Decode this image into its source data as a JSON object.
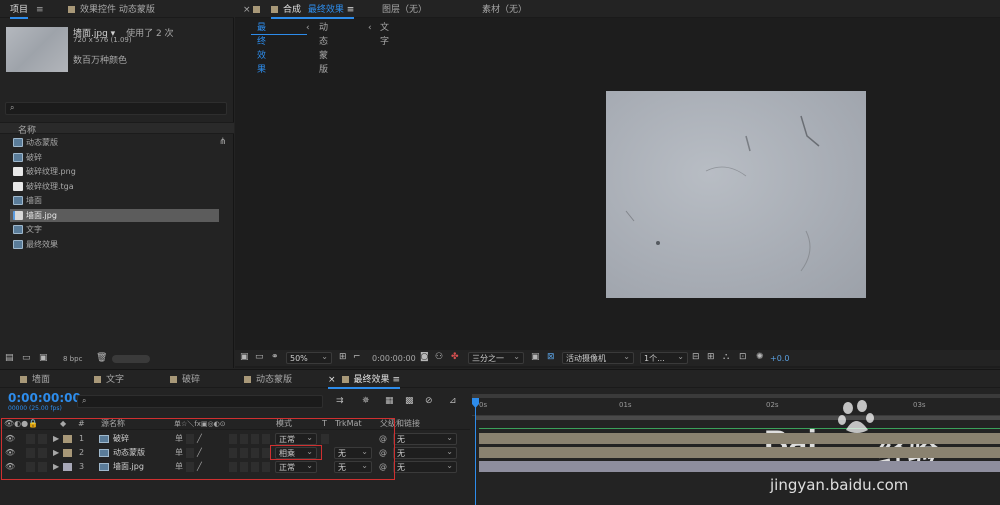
{
  "project_panel": {
    "tab_project": "项目",
    "tab_effects": "效果控件 动态蒙版",
    "file_name": "墙面.jpg",
    "file_menu": "▾",
    "used_count": "使用了 2 次",
    "dimensions": "720 x 576 (1.09)",
    "colors": "数百万种颜色",
    "search_placeholder": "",
    "column_name": "名称",
    "items": [
      {
        "name": "动态蒙版",
        "type": "comp"
      },
      {
        "name": "破碎",
        "type": "comp"
      },
      {
        "name": "破碎纹理.png",
        "type": "file"
      },
      {
        "name": "破碎纹理.tga",
        "type": "file"
      },
      {
        "name": "墙面",
        "type": "comp"
      },
      {
        "name": "墙面.jpg",
        "type": "file2",
        "selected": true
      },
      {
        "name": "文字",
        "type": "comp"
      },
      {
        "name": "最终效果",
        "type": "comp"
      }
    ],
    "bpc": "8 bpc"
  },
  "viewer": {
    "close": "×",
    "comp_label": "合成",
    "comp_name": "最终效果",
    "layer_tab": "图层（无）",
    "footage_tab": "素材（无）",
    "breadcrumb": [
      "最终效果",
      "动态蒙版",
      "文字"
    ],
    "breadcrumb_sep": "‹",
    "zoom": "50%",
    "timecode": "0:00:00:00",
    "resolution": "三分之一",
    "camera": "活动摄像机",
    "views": "1个...",
    "exposure": "+0.0"
  },
  "timeline": {
    "tabs": [
      "墙面",
      "文字",
      "破碎",
      "动态蒙版",
      "最终效果"
    ],
    "active_tab": "最终效果",
    "menu": "≡",
    "timecode": "0:00:00:00",
    "fps": "00000 (25.00 fps)",
    "search_placeholder": "",
    "col_num": "#",
    "col_source": "源名称",
    "col_switches": "单☆＼fx▣◎◐⊙",
    "col_mode": "模式",
    "col_t": "T",
    "col_trkmat": "TrkMat",
    "col_parent": "父级和链接",
    "layers": [
      {
        "num": "1",
        "name": "破碎",
        "mode": "正常",
        "trkmat": "",
        "parent": "无",
        "color": "#a89878"
      },
      {
        "num": "2",
        "name": "动态蒙版",
        "mode": "相乘",
        "trkmat": "无",
        "parent": "无",
        "color": "#a89878"
      },
      {
        "num": "3",
        "name": "墙面.jpg",
        "mode": "正常",
        "trkmat": "无",
        "parent": "无",
        "color": "#a8a8b8"
      }
    ],
    "ruler": [
      "0s",
      "01s",
      "02s",
      "03s"
    ]
  },
  "watermark": {
    "brand": "Bai",
    "cn": "经验",
    "url": "jingyan.baidu.com"
  }
}
